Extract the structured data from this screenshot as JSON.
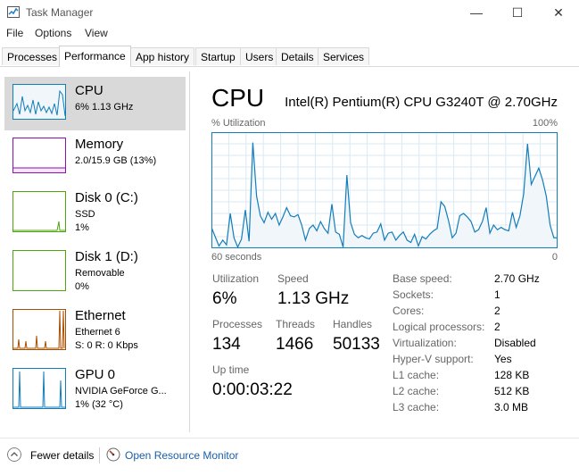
{
  "window": {
    "title": "Task Manager",
    "minimize_glyph": "—",
    "maximize_glyph": "☐",
    "close_glyph": "✕"
  },
  "menu": [
    "File",
    "Options",
    "View"
  ],
  "tabs": [
    "Processes",
    "Performance",
    "App history",
    "Startup",
    "Users",
    "Details",
    "Services"
  ],
  "active_tab": "Performance",
  "resources": [
    {
      "name": "CPU",
      "line1": "6% 1.13 GHz",
      "line2": "",
      "color": "#117dbb"
    },
    {
      "name": "Memory",
      "line1": "2.0/15.9 GB (13%)",
      "line2": "",
      "color": "#8b12ae"
    },
    {
      "name": "Disk 0 (C:)",
      "line1": "SSD",
      "line2": "1%",
      "color": "#4da60c"
    },
    {
      "name": "Disk 1 (D:)",
      "line1": "Removable",
      "line2": "0%",
      "color": "#4da60c"
    },
    {
      "name": "Ethernet",
      "line1": "Ethernet 6",
      "line2": "S: 0 R: 0 Kbps",
      "color": "#a74f01"
    },
    {
      "name": "GPU 0",
      "line1": "NVIDIA GeForce G...",
      "line2": "1% (32 °C)",
      "color": "#117dbb"
    }
  ],
  "main": {
    "title": "CPU",
    "model": "Intel(R) Pentium(R) CPU G3240T @ 2.70GHz",
    "graph_top_left": "% Utilization",
    "graph_top_right": "100%",
    "graph_bottom_left": "60 seconds",
    "graph_bottom_right": "0"
  },
  "stats": {
    "utilization_label": "Utilization",
    "utilization": "6%",
    "speed_label": "Speed",
    "speed": "1.13 GHz",
    "processes_label": "Processes",
    "processes": "134",
    "threads_label": "Threads",
    "threads": "1466",
    "handles_label": "Handles",
    "handles": "50133",
    "uptime_label": "Up time",
    "uptime": "0:00:03:22"
  },
  "info": [
    {
      "label": "Base speed:",
      "value": "2.70 GHz"
    },
    {
      "label": "Sockets:",
      "value": "1"
    },
    {
      "label": "Cores:",
      "value": "2"
    },
    {
      "label": "Logical processors:",
      "value": "2"
    },
    {
      "label": "Virtualization:",
      "value": "Disabled"
    },
    {
      "label": "Hyper-V support:",
      "value": "Yes"
    },
    {
      "label": "L1 cache:",
      "value": "128 KB"
    },
    {
      "label": "L2 cache:",
      "value": "512 KB"
    },
    {
      "label": "L3 cache:",
      "value": "3.0 MB"
    }
  ],
  "footer": {
    "fewer_details": "Fewer details",
    "open_resource_monitor": "Open Resource Monitor"
  },
  "cpu_history_percent": [
    18,
    10,
    2,
    7,
    3,
    30,
    9,
    1,
    8,
    33,
    6,
    91,
    45,
    28,
    22,
    31,
    25,
    30,
    20,
    27,
    35,
    28,
    27,
    29,
    20,
    7,
    17,
    20,
    15,
    23,
    17,
    13,
    38,
    14,
    12,
    1,
    63,
    22,
    12,
    9,
    11,
    9,
    8,
    13,
    14,
    21,
    7,
    13,
    14,
    7,
    11,
    14,
    7,
    5,
    12,
    2,
    10,
    8,
    12,
    15,
    17,
    40,
    36,
    24,
    9,
    13,
    28,
    30,
    27,
    23,
    14,
    16,
    23,
    35,
    13,
    20,
    16,
    18,
    16,
    15,
    31,
    18,
    28,
    47,
    90,
    55,
    62,
    69,
    59,
    45,
    20,
    9,
    9
  ]
}
